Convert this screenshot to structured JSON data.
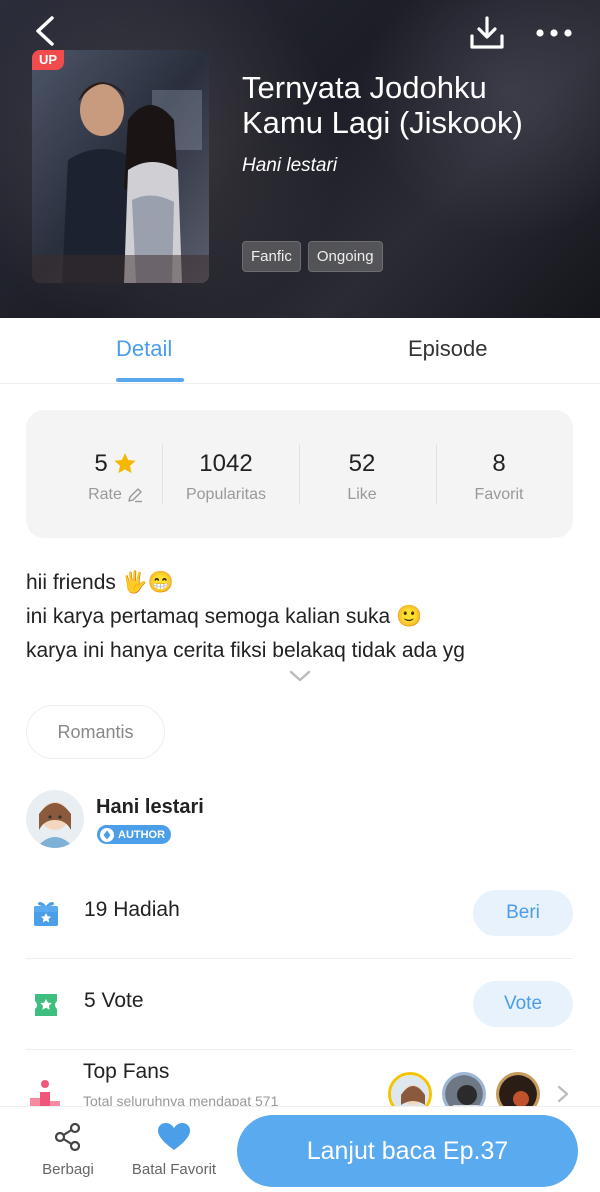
{
  "header": {
    "up_badge": "UP",
    "title": "Ternyata Jodohku Kamu Lagi (Jiskook)",
    "author": "Hani lestari",
    "tags": [
      "Fanfic",
      "Ongoing"
    ],
    "icons": {
      "back": "back-arrow-icon",
      "download": "download-icon",
      "more": "more-dots-icon"
    }
  },
  "tabs": {
    "detail": "Detail",
    "episode": "Episode",
    "active": "Detail"
  },
  "stats": [
    {
      "value": "5",
      "label": "Rate"
    },
    {
      "value": "1042",
      "label": "Popularitas"
    },
    {
      "value": "52",
      "label": "Like"
    },
    {
      "value": "8",
      "label": "Favorit"
    }
  ],
  "synopsis": {
    "line1": "hii friends 🖐😁",
    "line2": "ini karya pertamaq semoga kalian suka 🙂",
    "line3": "karya ini hanya cerita fiksi belakaq tidak ada yg"
  },
  "genre": "Romantis",
  "author_row": {
    "name": "Hani lestari",
    "badge": "AUTHOR"
  },
  "gifts": {
    "count": "19",
    "label": "Hadiah",
    "button": "Beri"
  },
  "votes": {
    "count": "5",
    "label": "Vote",
    "button": "Vote"
  },
  "top_fans": {
    "title": "Top Fans",
    "subtitle": "Total seluruhnya mendapat 571"
  },
  "bottom_bar": {
    "share_label": "Berbagi",
    "favorite_label": "Batal Favorit",
    "continue_label": "Lanjut baca Ep.37"
  },
  "colors": {
    "accent": "#5aaaf0",
    "active_tab": "#4a9ded",
    "up_badge": "#f24b4b",
    "star": "#f5b800"
  }
}
